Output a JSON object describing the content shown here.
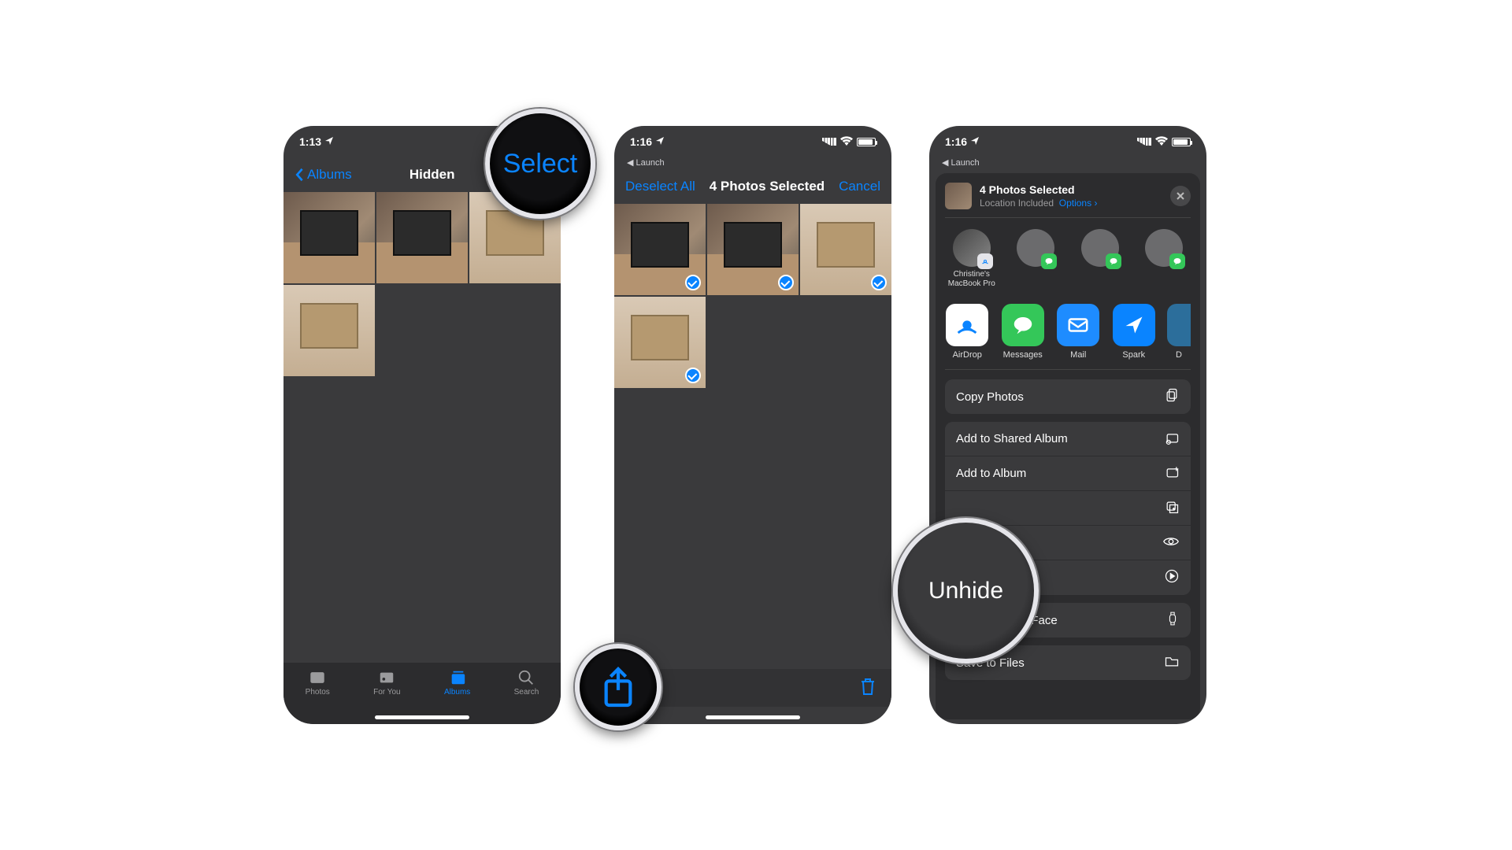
{
  "screen1": {
    "time": "1:13",
    "nav": {
      "back": "Albums",
      "title": "Hidden",
      "select": "Select"
    },
    "tabs": [
      "Photos",
      "For You",
      "Albums",
      "Search"
    ],
    "tabs_active": 2
  },
  "screen2": {
    "time": "1:16",
    "backapp": "Launch",
    "nav": {
      "deselect": "Deselect All",
      "title": "4 Photos Selected",
      "cancel": "Cancel"
    }
  },
  "screen3": {
    "time": "1:16",
    "backapp": "Launch",
    "header": {
      "title": "4 Photos Selected",
      "sub_location": "Location Included",
      "sub_options": "Options"
    },
    "contacts": [
      {
        "name": "Christine's MacBook Pro",
        "badge": "airdrop"
      },
      {
        "name": "",
        "badge": "messages"
      },
      {
        "name": "",
        "badge": "messages"
      },
      {
        "name": "",
        "badge": "messages"
      }
    ],
    "apps": [
      {
        "name": "AirDrop",
        "color": "#ffffff",
        "fg": "#0a84ff"
      },
      {
        "name": "Messages",
        "color": "#34c759"
      },
      {
        "name": "Mail",
        "color": "#1e8cff"
      },
      {
        "name": "Spark",
        "color": "#0a84ff"
      },
      {
        "name": "D",
        "color": "#2c6e9b"
      }
    ],
    "actions": {
      "copy": "Copy Photos",
      "stack": [
        "Add to Shared Album",
        "Add to Album",
        "Duplicate",
        "Unhide",
        "Slideshow"
      ],
      "watch": "Create Watch Face",
      "files": "Save to Files"
    }
  },
  "callouts": {
    "select": "Select",
    "unhide": "Unhide"
  }
}
